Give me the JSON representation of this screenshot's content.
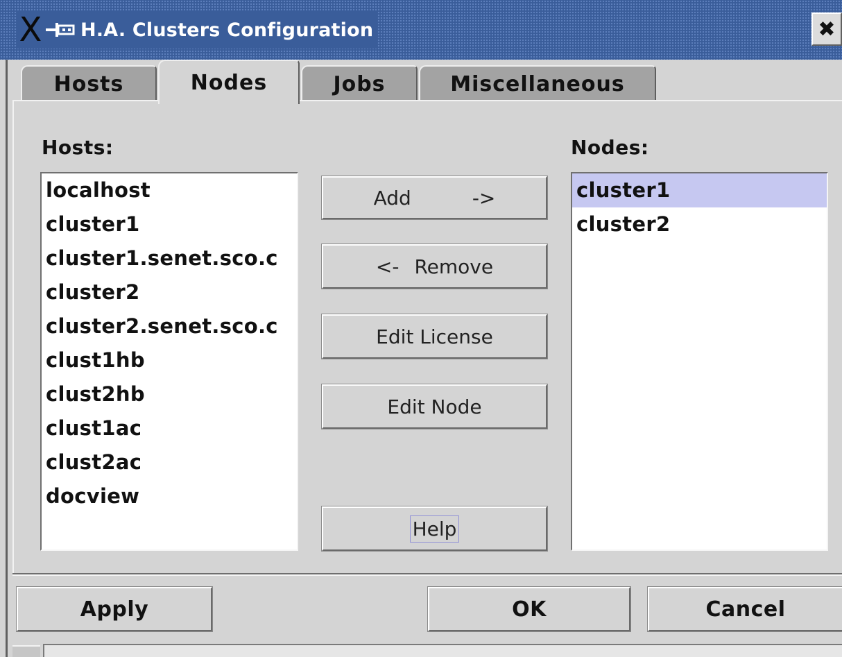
{
  "window": {
    "title": "H.A. Clusters Configuration",
    "logo_glyph": "X",
    "close_glyph": "✖",
    "titlebar_color": "#3a5d9a"
  },
  "tabs": [
    {
      "label": "Hosts",
      "selected": false
    },
    {
      "label": "Nodes",
      "selected": true
    },
    {
      "label": "Jobs",
      "selected": false
    },
    {
      "label": "Miscellaneous",
      "selected": false
    }
  ],
  "hosts": {
    "label": "Hosts:",
    "items": [
      "localhost",
      "cluster1",
      "cluster1.senet.sco.c",
      "cluster2",
      "cluster2.senet.sco.c",
      "clust1hb",
      "clust2hb",
      "clust1ac",
      "clust2ac",
      "docview"
    ]
  },
  "nodes": {
    "label": "Nodes:",
    "items": [
      "cluster1",
      "cluster2"
    ],
    "selected_item": "cluster1",
    "selection_color": "#c6c8f1"
  },
  "actions": {
    "add_label": "Add",
    "add_arrow": "->",
    "remove_arrow": "<-",
    "remove_label": "Remove",
    "edit_license": "Edit License",
    "edit_node": "Edit Node",
    "help": "Help"
  },
  "footer": {
    "apply": "Apply",
    "ok": "OK",
    "cancel": "Cancel"
  },
  "icons": {
    "window_logo": "x-logo-icon",
    "pin": "pin-icon",
    "close": "close-icon"
  }
}
